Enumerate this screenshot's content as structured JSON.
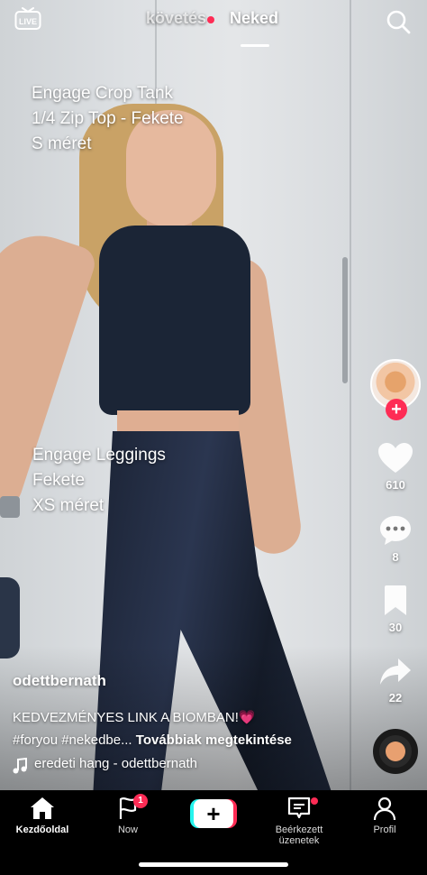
{
  "header": {
    "live_label": "LIVE",
    "tabs": [
      {
        "label": "követés",
        "active": false,
        "has_dot": true
      },
      {
        "label": "Neked",
        "active": true
      }
    ]
  },
  "overlay_text": {
    "block1": [
      "Engage Crop Tank",
      "1/4 Zip Top - Fekete",
      "S méret"
    ],
    "block2": [
      "Engage Leggings",
      "Fekete",
      "XS méret"
    ]
  },
  "rail": {
    "likes": "610",
    "comments": "8",
    "saves": "30",
    "shares": "22"
  },
  "post": {
    "username": "odettbernath",
    "description_line1": "KEDVEZMÉNYES LINK A BIOMBAN!",
    "description_emoji": "💗",
    "description_line2": "#foryou #nekedbe...",
    "see_more": "Továbbiak megtekintése",
    "sound": "eredeti hang - odettbernath"
  },
  "nav": {
    "home": "Kezdőoldal",
    "now": "Now",
    "now_badge": "1",
    "inbox": "Beérkezett üzenetek",
    "profile": "Profil"
  },
  "colors": {
    "accent_red": "#fe2c55",
    "accent_cyan": "#25f4ee",
    "nav_bg": "#000000"
  },
  "icons": [
    "live-icon",
    "search-icon",
    "heart-icon",
    "comment-icon",
    "bookmark-icon",
    "share-icon",
    "music-note-icon",
    "home-icon",
    "now-icon",
    "create-icon",
    "inbox-icon",
    "profile-icon"
  ]
}
